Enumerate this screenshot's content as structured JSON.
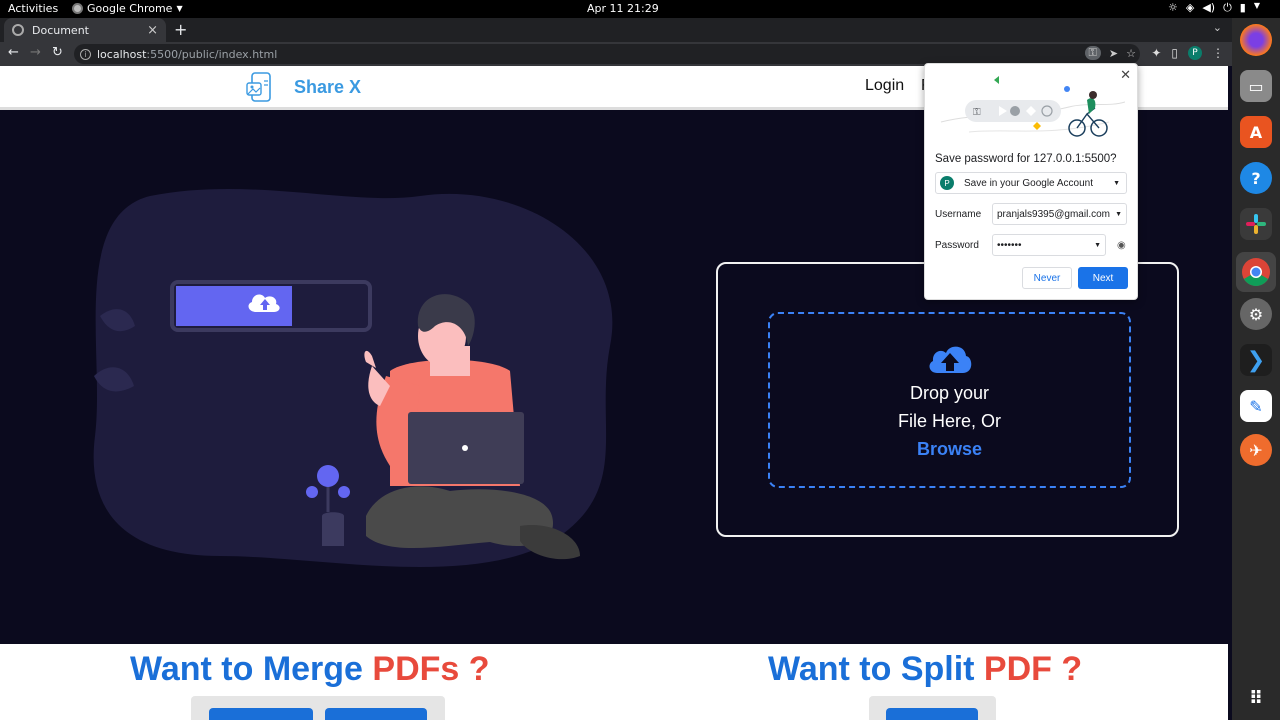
{
  "topbar": {
    "activities": "Activities",
    "app_name": "Google Chrome",
    "clock": "Apr 11  21:29"
  },
  "browser": {
    "tab_title": "Document",
    "url_host": "localhost",
    "url_path": ":5500/public/index.html"
  },
  "site": {
    "brand": "Share X",
    "nav_login": "Login",
    "nav_second": "R",
    "drop_line1": "Drop your",
    "drop_line2": "File Here, Or",
    "drop_browse": "Browse",
    "merge_prefix": "Want to Merge ",
    "merge_highlight": "PDFs ?",
    "split_prefix": "Want to Split ",
    "split_highlight": "PDF ?"
  },
  "password_popup": {
    "title": "Save password for 127.0.0.1:5500?",
    "account_initial": "P",
    "account_label": "Save in your Google Account",
    "username_label": "Username",
    "username_value": "pranjals9395@gmail.com",
    "password_label": "Password",
    "password_value": "•••••••",
    "never_button": "Never",
    "next_button": "Next"
  },
  "profile_initial": "P",
  "colors": {
    "hero_bg": "#0b0a1e",
    "brand_blue": "#3b9ae1",
    "accent_blue": "#1a6fd8",
    "accent_red": "#e84a3c",
    "chrome_blue": "#1a73e8"
  },
  "dock": [
    "firefox-icon",
    "files-icon",
    "software-icon",
    "help-icon",
    "slack-icon",
    "chrome-icon",
    "settings-icon",
    "vscode-icon",
    "text-editor-icon",
    "postman-icon",
    "app-grid-icon"
  ]
}
